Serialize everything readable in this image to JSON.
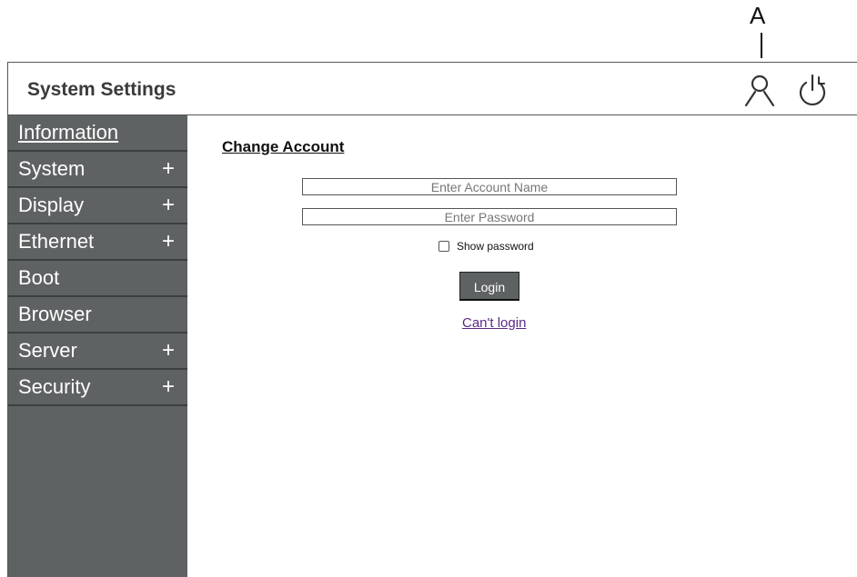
{
  "callout": {
    "letter": "A"
  },
  "header": {
    "title": "System Settings",
    "icons": [
      "user-icon",
      "power-icon"
    ]
  },
  "sidebar": {
    "items": [
      {
        "label": "Information",
        "expandable": false,
        "active": true
      },
      {
        "label": "System",
        "expandable": true,
        "expand_symbol": "+"
      },
      {
        "label": "Display",
        "expandable": true,
        "expand_symbol": "+"
      },
      {
        "label": "Ethernet",
        "expandable": true,
        "expand_symbol": "+"
      },
      {
        "label": "Boot",
        "expandable": false
      },
      {
        "label": "Browser",
        "expandable": false
      },
      {
        "label": "Server",
        "expandable": true,
        "expand_symbol": "+"
      },
      {
        "label": "Security",
        "expandable": true,
        "expand_symbol": "+"
      }
    ]
  },
  "main": {
    "section_title": "Change Account",
    "account_placeholder": "Enter Account Name",
    "password_placeholder": "Enter Password",
    "show_password_label": "Show password",
    "login_label": "Login",
    "cant_login_label": "Can't login"
  },
  "colors": {
    "sidebar_bg": "#5e6263",
    "link": "#5a2a86"
  }
}
